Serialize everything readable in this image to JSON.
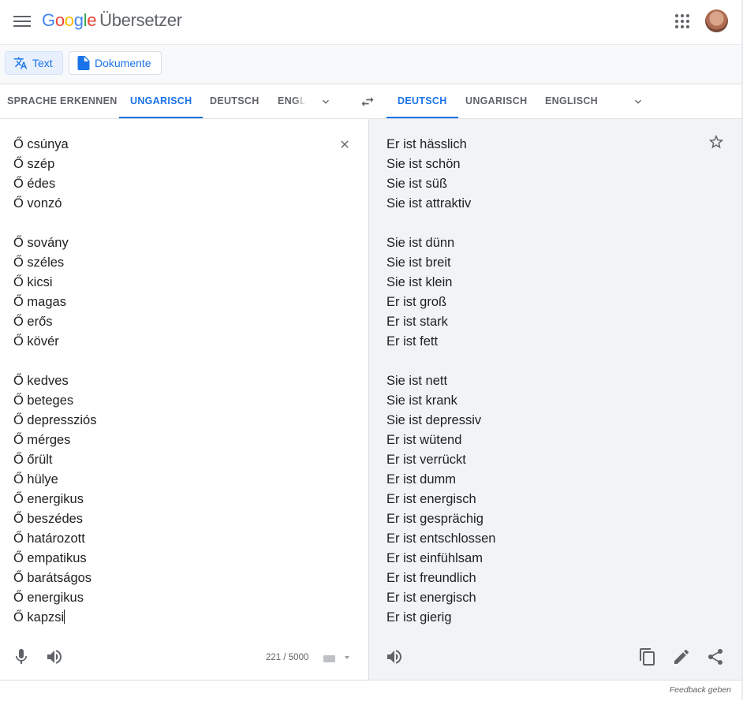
{
  "header": {
    "logo_letters": [
      "G",
      "o",
      "o",
      "g",
      "l",
      "e"
    ],
    "product": "Übersetzer",
    "menu_icon": "hamburger-menu-icon",
    "apps_icon": "apps-grid-icon",
    "avatar_icon": "user-avatar"
  },
  "modes": {
    "text_label": "Text",
    "documents_label": "Dokumente"
  },
  "source_langs": {
    "detect": "SPRACHE ERKENNEN",
    "l1": "UNGARISCH",
    "l2": "DEUTSCH",
    "l3": "ENGLISCH"
  },
  "target_langs": {
    "l1": "DEUTSCH",
    "l2": "UNGARISCH",
    "l3": "ENGLISCH"
  },
  "source_text": [
    "Ő csúnya",
    "Ő szép",
    "Ő édes",
    "Ő vonzó",
    "",
    "Ő sovány",
    "Ő széles",
    "Ő kicsi",
    "Ő magas",
    "Ő erős",
    "Ő kövér",
    "",
    "Ő kedves",
    "Ő beteges",
    "Ő depressziós",
    "Ő mérges",
    "Ő őrült",
    "Ő hülye",
    "Ő energikus",
    "Ő beszédes",
    "Ő határozott",
    "Ő empatikus",
    "Ő barátságos",
    "Ő energikus",
    "Ő kapzsi"
  ],
  "target_text": [
    "Er ist hässlich",
    "Sie ist schön",
    "Sie ist süß",
    "Sie ist attraktiv",
    "",
    "Sie ist dünn",
    "Sie ist breit",
    "Sie ist klein",
    "Er ist groß",
    "Er ist stark",
    "Er ist fett",
    "",
    "Sie ist nett",
    "Sie ist krank",
    "Sie ist depressiv",
    "Er ist wütend",
    "Er ist verrückt",
    "Er ist dumm",
    "Er ist energisch",
    "Er ist gesprächig",
    "Er ist entschlossen",
    "Er ist einfühlsam",
    "Er ist freundlich",
    "Er ist energisch",
    "Er ist gierig"
  ],
  "counter": "221 / 5000",
  "feedback": "Feedback geben",
  "colors": {
    "accent": "#1a73e8",
    "target_bg": "#f1f3f4",
    "icon_gray": "#5f6368"
  }
}
